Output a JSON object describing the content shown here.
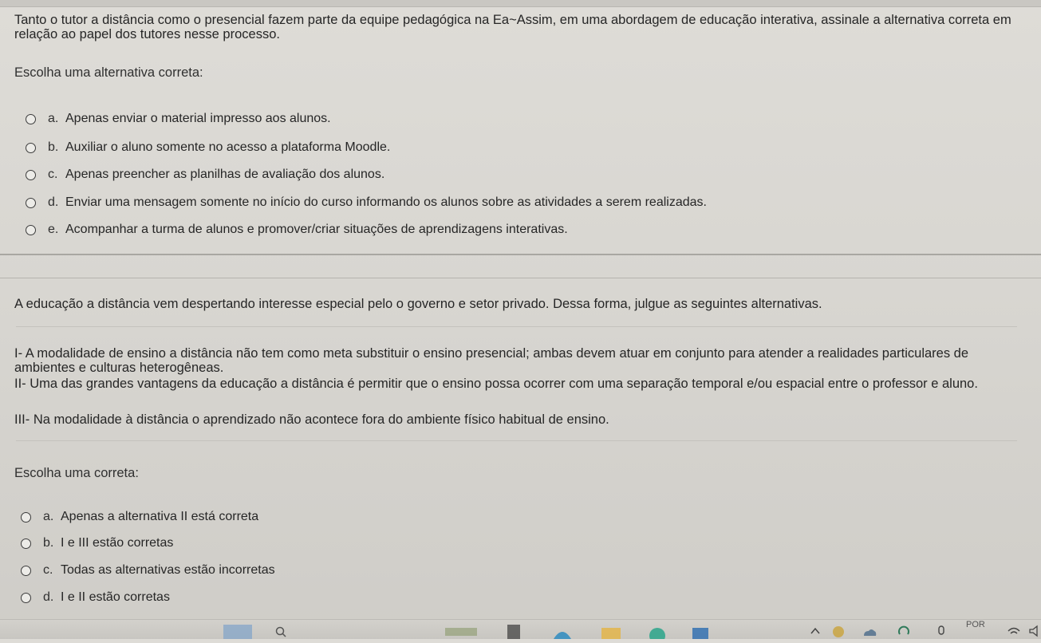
{
  "question1": {
    "text": "Tanto o tutor a distância como o presencial fazem parte da equipe pedagógica na Ea~Assim, em uma abordagem de educação interativa, assinale a alternativa correta em relação ao papel dos tutores nesse processo.",
    "prompt": "Escolha uma alternativa correta:",
    "options": [
      {
        "letter": "a.",
        "text": "Apenas enviar o material impresso aos alunos."
      },
      {
        "letter": "b.",
        "text": "Auxiliar o aluno somente no acesso a plataforma Moodle."
      },
      {
        "letter": "c.",
        "text": "Apenas preencher as planilhas de avaliação dos alunos."
      },
      {
        "letter": "d.",
        "text": "Enviar uma mensagem somente no início do curso informando os alunos sobre as atividades a serem realizadas."
      },
      {
        "letter": "e.",
        "text": "Acompanhar a turma de alunos e promover/criar situações de aprendizagens interativas."
      }
    ]
  },
  "question2": {
    "text": "A educação a distância vem despertando interesse especial pelo o governo e setor privado. Dessa forma, julgue as seguintes alternativas.",
    "statements": [
      "I- A modalidade de ensino a distância não tem como meta substituir o ensino presencial; ambas devem atuar em conjunto para atender a realidades particulares de ambientes e culturas heterogêneas.",
      "II- Uma das grandes vantagens da educação a distância é permitir que o ensino possa ocorrer com uma separação temporal e/ou espacial entre o professor e aluno.",
      "III- Na modalidade à distância o aprendizado não acontece fora do ambiente físico habitual de ensino."
    ],
    "prompt": "Escolha uma correta:",
    "options": [
      {
        "letter": "a.",
        "text": "Apenas a alternativa II está correta"
      },
      {
        "letter": "b.",
        "text": "I e III estão corretas"
      },
      {
        "letter": "c.",
        "text": "Todas as alternativas estão incorretas"
      },
      {
        "letter": "d.",
        "text": "I e II estão corretas"
      }
    ]
  },
  "taskbar": {
    "language": "POR"
  },
  "colors": {
    "background": "#d8d6d1",
    "text": "#262626",
    "radio_border": "#3c3c3c"
  }
}
